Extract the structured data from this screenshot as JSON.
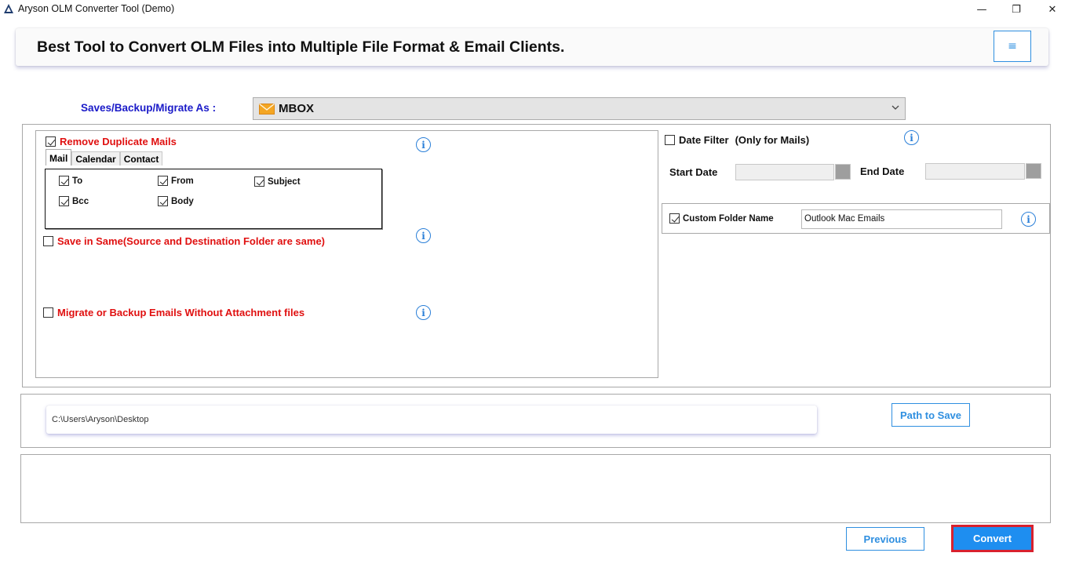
{
  "window": {
    "title": "Aryson OLM Converter Tool (Demo)",
    "minimize_glyph": "—",
    "maximize_glyph": "❐",
    "close_glyph": "✕"
  },
  "header": {
    "title": "Best Tool to Convert OLM Files into Multiple File Format & Email Clients.",
    "menu_glyph": "≡"
  },
  "saves_as": {
    "label": "Saves/Backup/Migrate As :",
    "selected": "MBOX"
  },
  "options": {
    "remove_duplicates": {
      "label": "Remove Duplicate Mails",
      "checked": true
    },
    "tabs": [
      {
        "label": "Mail",
        "active": true
      },
      {
        "label": "Calendar",
        "active": false
      },
      {
        "label": "Contact",
        "active": false
      }
    ],
    "mail_fields": [
      {
        "label": "To",
        "checked": true
      },
      {
        "label": "From",
        "checked": true
      },
      {
        "label": "Subject",
        "checked": true
      },
      {
        "label": "Bcc",
        "checked": true
      },
      {
        "label": "Body",
        "checked": true
      }
    ],
    "save_in_same": {
      "label": "Save in Same(Source and Destination Folder are same)",
      "checked": false
    },
    "without_attachments": {
      "label": "Migrate or Backup Emails Without Attachment files",
      "checked": false
    },
    "info_glyph": "i"
  },
  "date_filter": {
    "label": "Date Filter",
    "note": "(Only for Mails)",
    "checked": false,
    "start_label": "Start Date",
    "end_label": "End Date",
    "start_value": "",
    "end_value": ""
  },
  "custom_folder": {
    "label": "Custom Folder Name",
    "checked": true,
    "value": "Outlook Mac Emails"
  },
  "path": {
    "value": "C:\\Users\\Aryson\\Desktop",
    "button": "Path to Save"
  },
  "footer": {
    "previous": "Previous",
    "convert": "Convert"
  },
  "colors": {
    "accent": "#2f8fe0",
    "label_red": "#e01010",
    "label_blue": "#1a1ac8",
    "convert_bg": "#1e8ef0",
    "convert_border": "#d8212e"
  }
}
